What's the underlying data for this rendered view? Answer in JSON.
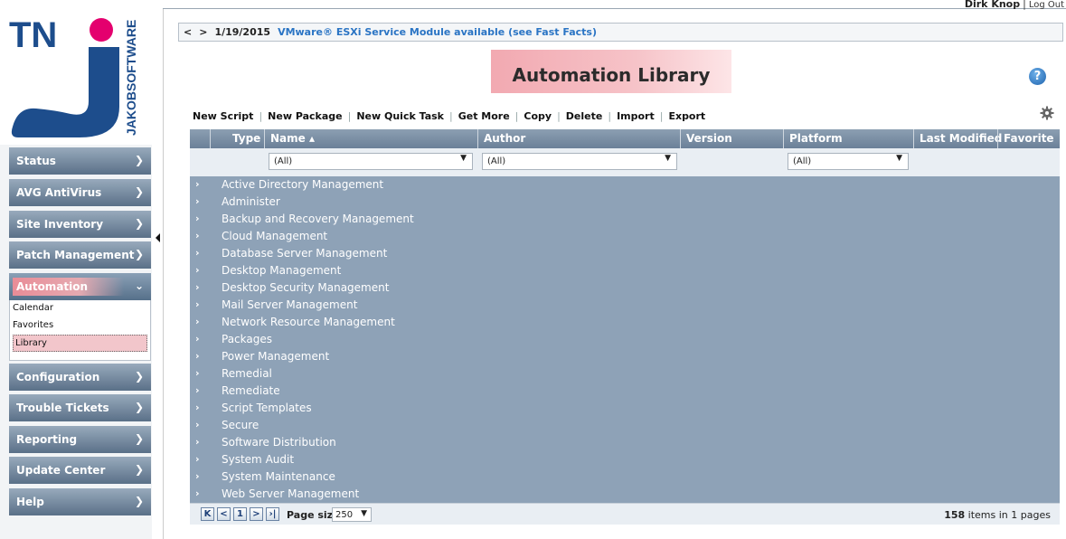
{
  "user": {
    "name": "Dirk Knop",
    "separator": "|",
    "logout": "Log Out"
  },
  "news": {
    "prev": "<",
    "next": ">",
    "date": "1/19/2015",
    "text": "VMware® ESXi Service Module available (see Fast Facts)"
  },
  "logo": {
    "short": "TN",
    "vertical": "JAKOBSOFTWARE"
  },
  "sidebar": {
    "items": [
      {
        "label": "Status"
      },
      {
        "label": "AVG AntiVirus"
      },
      {
        "label": "Site Inventory"
      },
      {
        "label": "Patch Management"
      },
      {
        "label": "Automation"
      },
      {
        "label": "Configuration"
      },
      {
        "label": "Trouble Tickets"
      },
      {
        "label": "Reporting"
      },
      {
        "label": "Update Center"
      },
      {
        "label": "Help"
      }
    ],
    "automation_sub": [
      "Calendar",
      "Favorites",
      "Library"
    ]
  },
  "page": {
    "title": "Automation Library",
    "help": "?"
  },
  "toolbar": [
    "New Script",
    "New Package",
    "New Quick Task",
    "Get More",
    "Copy",
    "Delete",
    "Import",
    "Export"
  ],
  "grid": {
    "columns": {
      "type": "Type",
      "name": "Name ▴",
      "author": "Author",
      "version": "Version",
      "platform": "Platform",
      "modified": "Last Modified",
      "favorite": "Favorite"
    },
    "filters": {
      "name": "(All)",
      "author": "(All)",
      "platform": "(All)"
    },
    "rows": [
      "Active Directory Management",
      "Administer",
      "Backup and Recovery Management",
      "Cloud Management",
      "Database Server Management",
      "Desktop Management",
      "Desktop Security Management",
      "Mail Server Management",
      "Network Resource Management",
      "Packages",
      "Power Management",
      "Remedial",
      "Remediate",
      "Script Templates",
      "Secure",
      "Software Distribution",
      "System Audit",
      "System Maintenance",
      "Web Server Management"
    ],
    "pager": {
      "first": "K",
      "prev": "<",
      "current": "1",
      "next": ">",
      "last": "›|",
      "page_size_label": "Page size:",
      "page_size": "250",
      "items_count": "158",
      "items_text": "items in",
      "pages_count": "1",
      "pages_text": "pages"
    }
  },
  "colors": {
    "nav": "#5a7088",
    "grid_rows": "#8ea2b7",
    "title_highlight": "#f2a9b1",
    "accent_pink": "#e4006e",
    "link": "#2a74c4"
  }
}
